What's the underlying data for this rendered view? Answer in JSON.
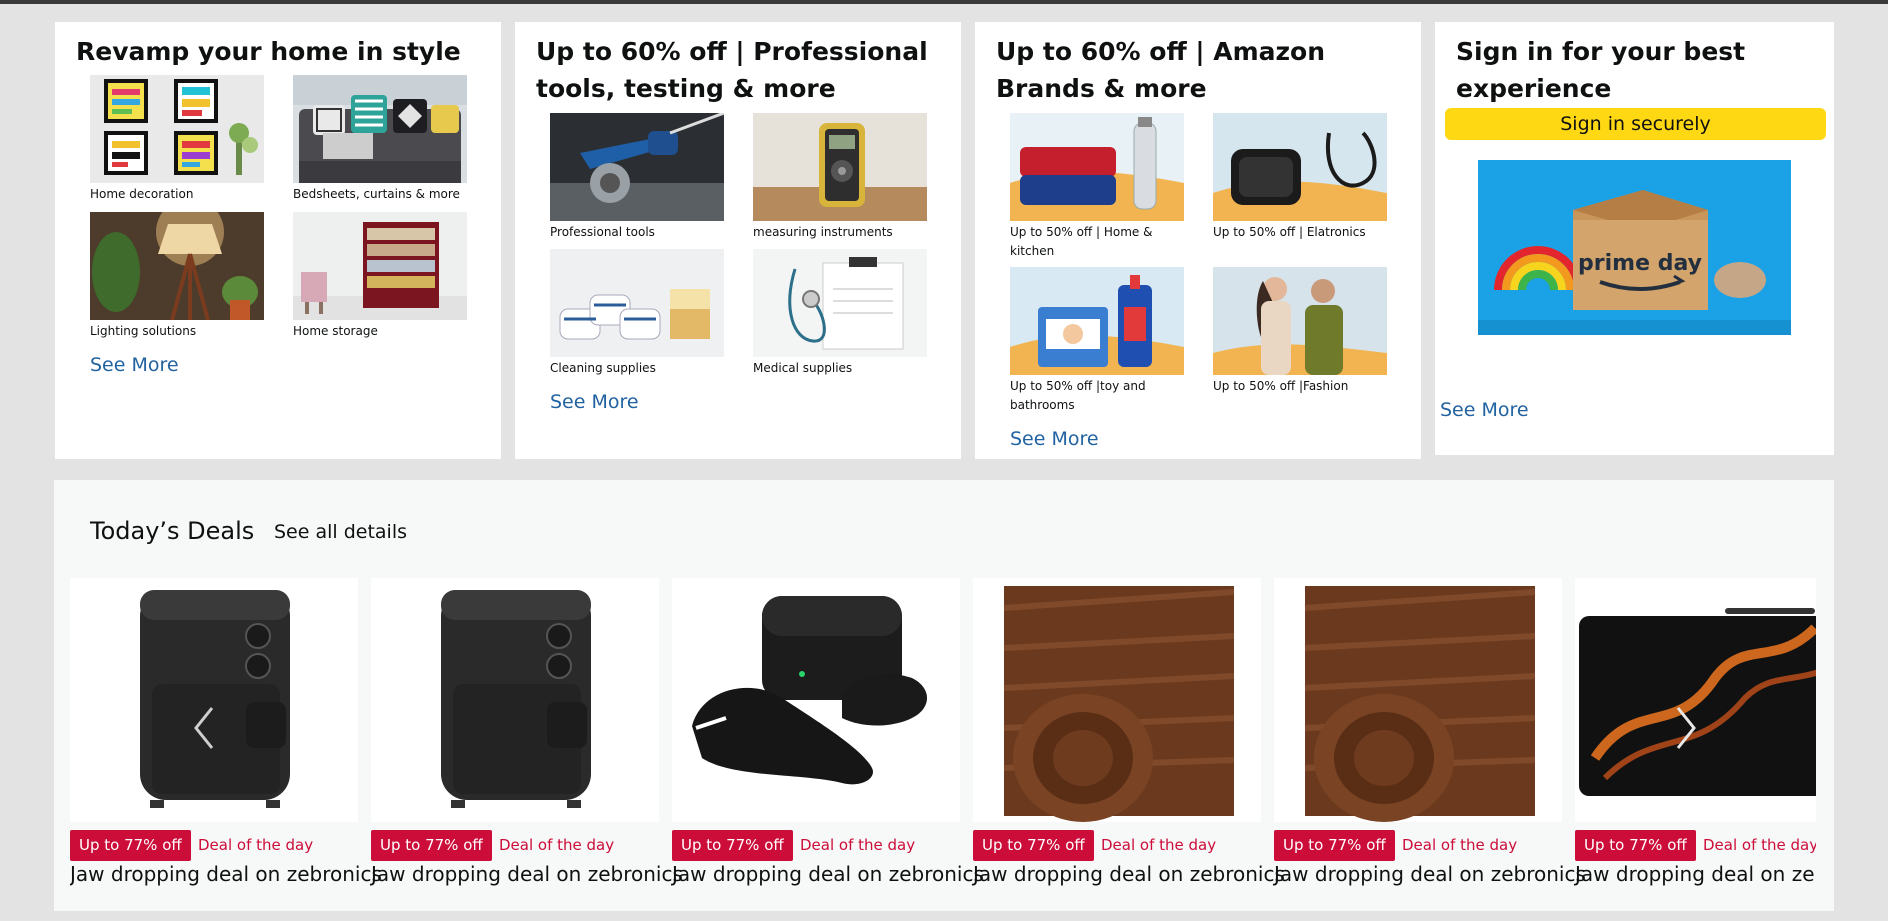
{
  "cards": [
    {
      "title": "Revamp your home in style",
      "tiles": [
        {
          "caption": "Home decoration"
        },
        {
          "caption": "Bedsheets, curtains & more"
        },
        {
          "caption": "Lighting solutions"
        },
        {
          "caption": "Home storage"
        }
      ],
      "see_more": "See More"
    },
    {
      "title": "Up to 60% off | Professional tools, testing & more",
      "tiles": [
        {
          "caption": "Professional tools"
        },
        {
          "caption": "measuring instruments"
        },
        {
          "caption": "Cleaning supplies"
        },
        {
          "caption": "Medical supplies"
        }
      ],
      "see_more": "See More"
    },
    {
      "title": "Up to 60% off | Amazon Brands & more",
      "tiles": [
        {
          "caption": "Up to 50% off | Home & kitchen"
        },
        {
          "caption": "Up to 50% off | Elatronics"
        },
        {
          "caption": "Up to 50% off |toy and bathrooms"
        },
        {
          "caption": "Up to 50% off |Fashion"
        }
      ],
      "see_more": "See More"
    },
    {
      "title": "Sign in for your best experience",
      "button": "Sign in securely",
      "banner_text": "prime day",
      "see_more": "See More"
    }
  ],
  "deals": {
    "title": "Today’s Deals",
    "link": "See all details",
    "items": [
      {
        "badge": "Up to 77% off",
        "label": "Deal of the day",
        "title": "Jaw dropping deal on zebronics",
        "image": "air-fryer"
      },
      {
        "badge": "Up to 77% off",
        "label": "Deal of the day",
        "title": "Jaw dropping deal on zebronics",
        "image": "air-fryer"
      },
      {
        "badge": "Up to 77% off",
        "label": "Deal of the day",
        "title": "Jaw dropping deal on zebronics",
        "image": "earbuds"
      },
      {
        "badge": "Up to 77% off",
        "label": "Deal of the day",
        "title": "Jaw dropping deal on zebronics",
        "image": "wood-wallpaper"
      },
      {
        "badge": "Up to 77% off",
        "label": "Deal of the day",
        "title": "Jaw dropping deal on zebronics",
        "image": "wood-wallpaper"
      },
      {
        "badge": "Up to 77% off",
        "label": "Deal of the day",
        "title": "Jaw dropping deal on zebronics",
        "image": "tablet"
      }
    ]
  },
  "colors": {
    "page_bg": "#e3e3e3",
    "link": "#2162a1",
    "signin_button": "#ffd814",
    "deal_badge": "#cc0c39"
  }
}
